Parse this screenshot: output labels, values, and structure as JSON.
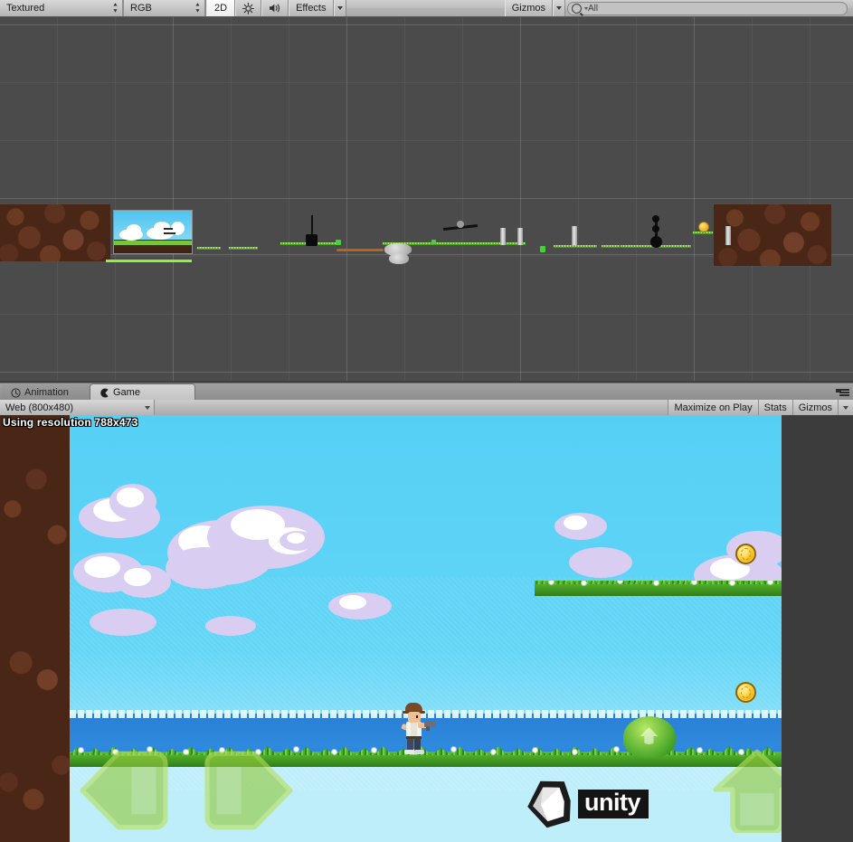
{
  "app": {
    "name": "Unity Editor"
  },
  "scene_toolbar": {
    "draw_mode": {
      "label": "Textured",
      "icon": "updown-arrows-icon"
    },
    "color_mode": {
      "label": "RGB",
      "icon": "updown-arrows-icon"
    },
    "mode_2d": {
      "label": "2D",
      "active": true
    },
    "lighting": {
      "icon": "sun-icon",
      "active": false
    },
    "audio": {
      "icon": "speaker-icon",
      "active": false
    },
    "effects": {
      "label": "Effects",
      "icon": "chevron-down-icon"
    },
    "gizmos": {
      "label": "Gizmos",
      "icon": "chevron-down-icon"
    },
    "search": {
      "value": "All",
      "placeholder": "All",
      "icon": "search-icon"
    }
  },
  "tabs": [
    {
      "label": "Animation",
      "icon": "clock-icon",
      "active": false
    },
    {
      "label": "Game",
      "icon": "game-icon",
      "active": true
    }
  ],
  "pane_menu": {
    "icon": "pane-options-icon"
  },
  "game_toolbar": {
    "resolution": {
      "label": "Web (800x480)",
      "icon": "chevron-down-icon"
    },
    "maximize_on_play": {
      "label": "Maximize on Play"
    },
    "stats": {
      "label": "Stats"
    },
    "gizmos": {
      "label": "Gizmos",
      "icon": "chevron-down-icon"
    }
  },
  "game_view": {
    "resolution_overlay": "Using resolution 788x473",
    "watermark": {
      "label": "unity",
      "icon": "unity-logo-icon"
    },
    "touch_controls": [
      {
        "name": "move-left-button",
        "icon": "arrow-left-icon"
      },
      {
        "name": "move-right-button",
        "icon": "arrow-right-icon"
      },
      {
        "name": "jump-button",
        "icon": "arrow-up-icon"
      }
    ],
    "colors": {
      "sky": "#55d0f5",
      "sea": "#2a7fd4",
      "grass": "#4eb02a",
      "dirt": "#52301c",
      "coin": "#f6c323",
      "button_green": "#8ec63f"
    },
    "entities": {
      "player": {
        "name": "player-character"
      },
      "coins": 2,
      "platforms": 1,
      "bush": 1
    }
  },
  "scene_view": {
    "background": "#4b4b4b",
    "grid": true,
    "camera_preview": {
      "name": "camera-preview"
    },
    "selection_outline_color": "#8ef23a"
  }
}
